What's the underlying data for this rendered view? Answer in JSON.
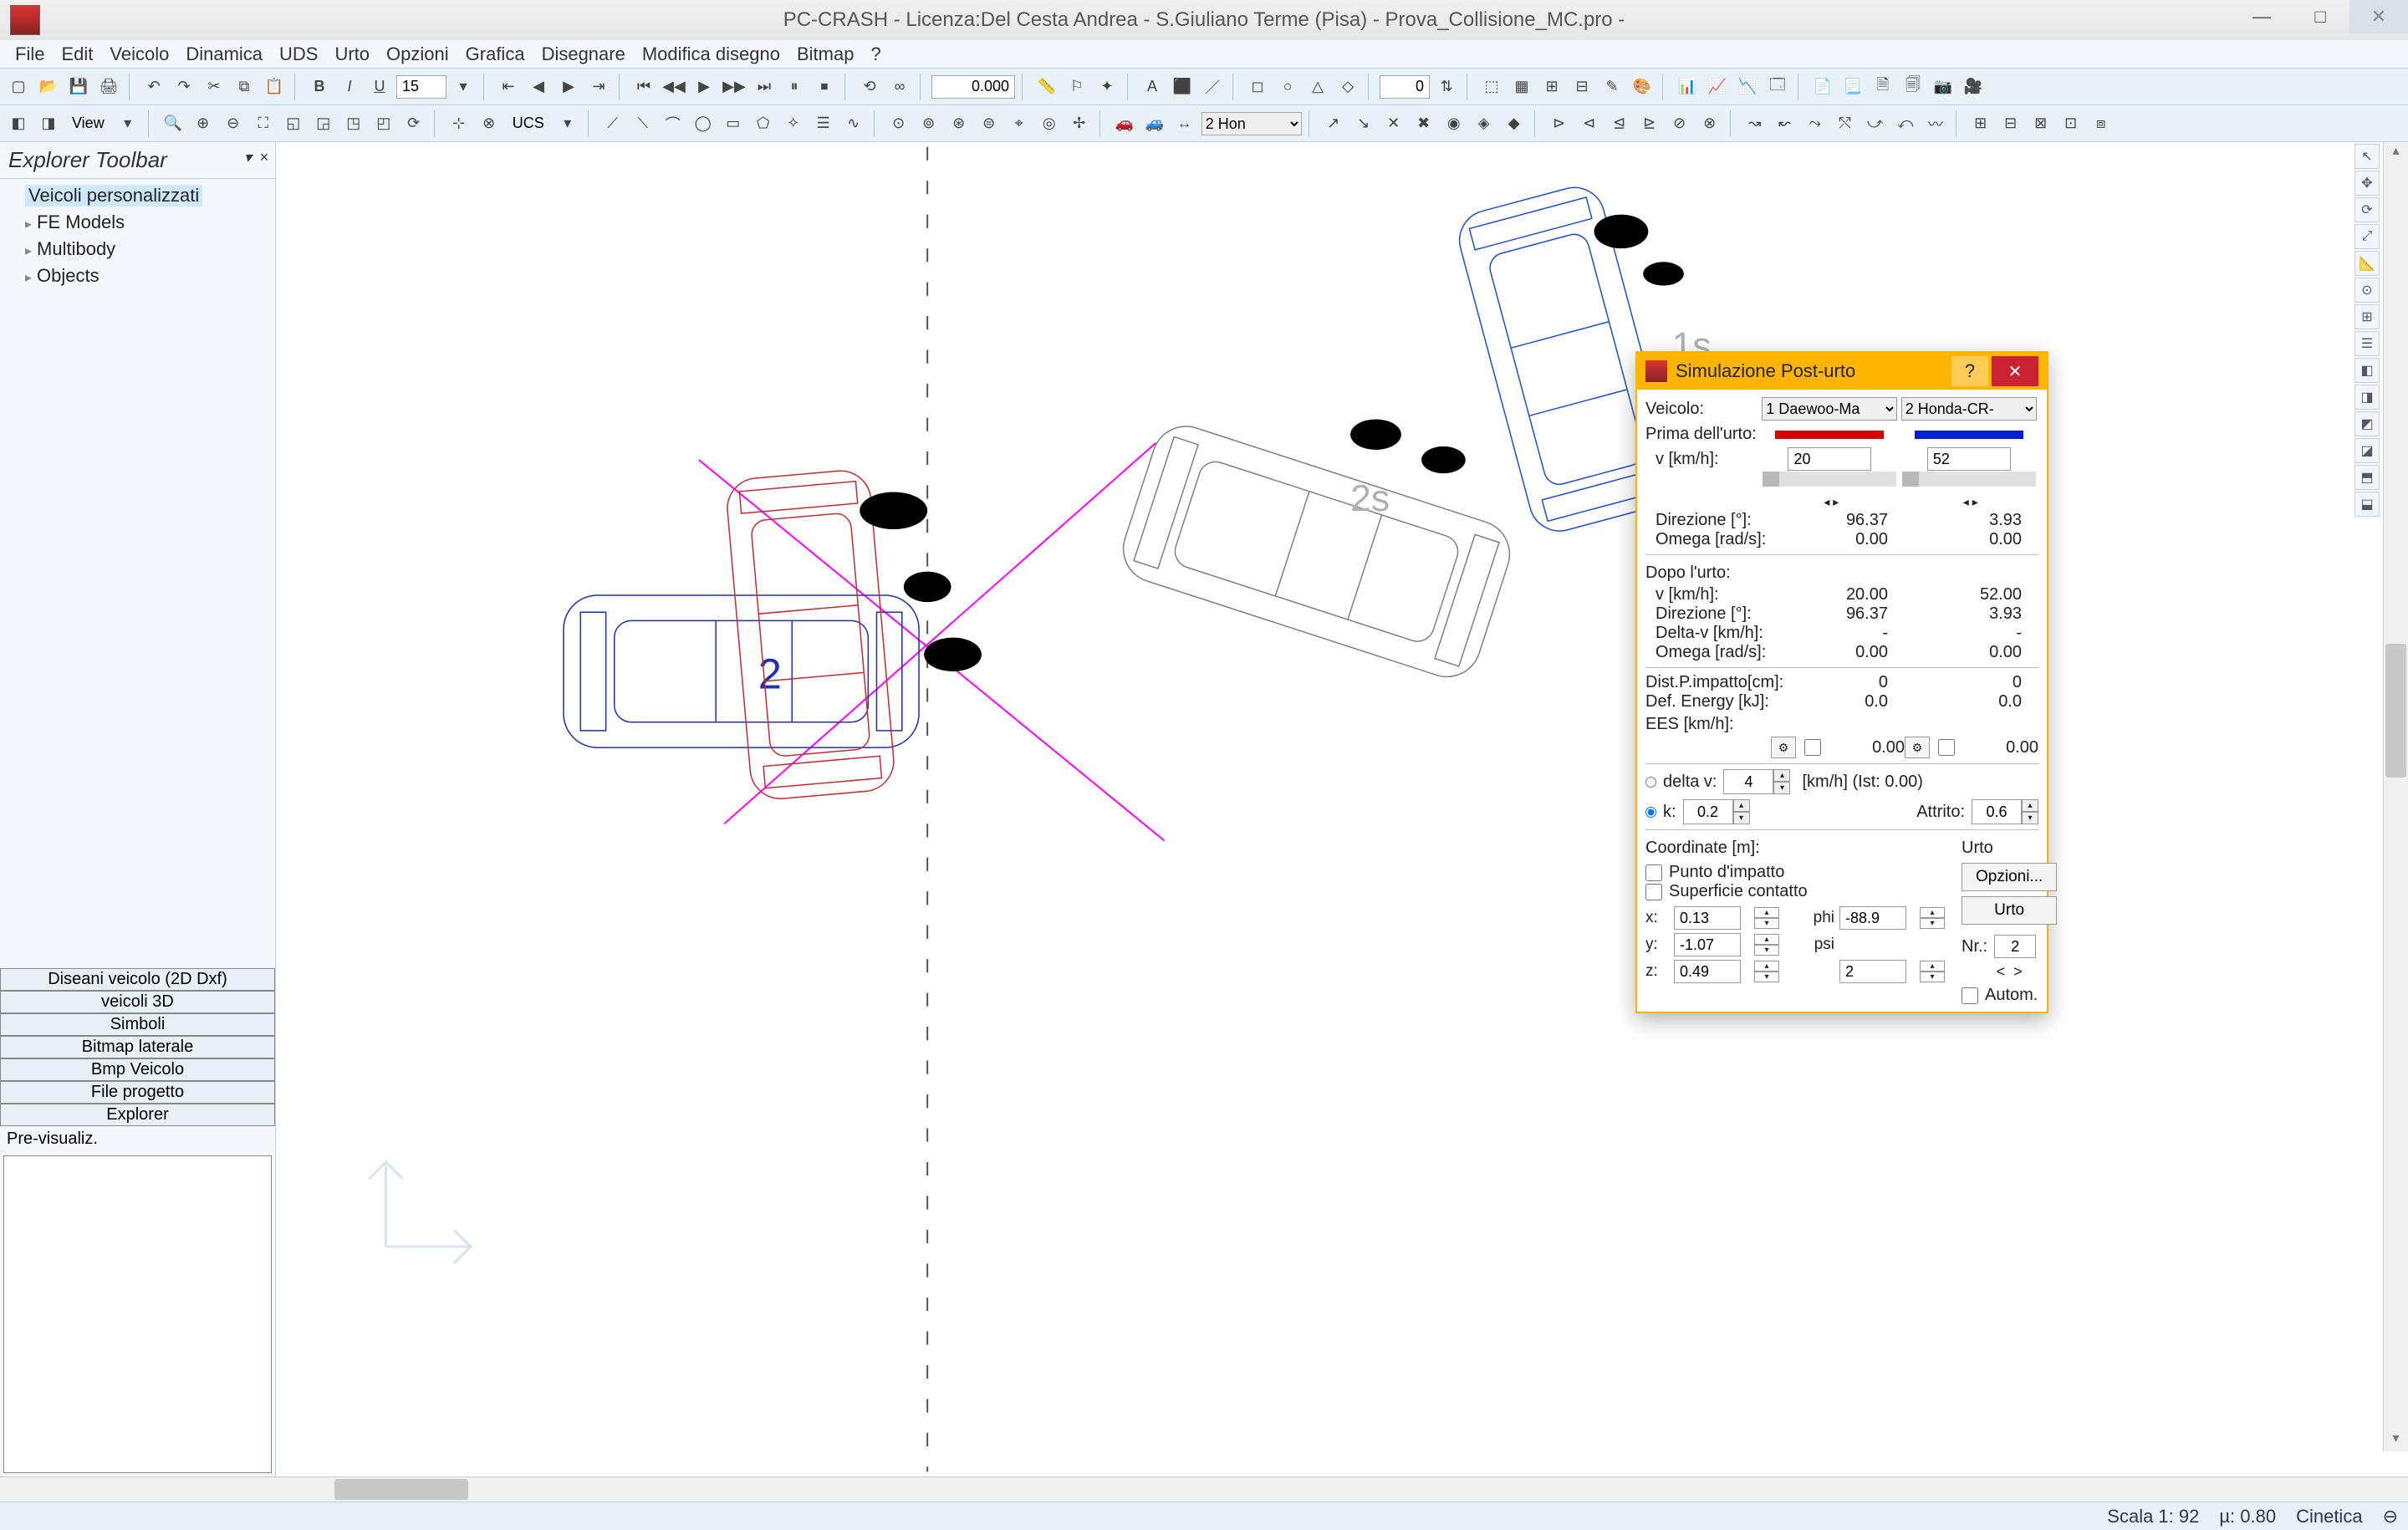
{
  "app": {
    "title": "PC-CRASH - Licenza:Del Cesta Andrea - S.Giuliano Terme (Pisa) - Prova_Collisione_MC.pro -"
  },
  "menu": [
    "File",
    "Edit",
    "Veicolo",
    "Dinamica",
    "UDS",
    "Urto",
    "Opzioni",
    "Grafica",
    "Disegnare",
    "Modifica disegno",
    "Bitmap",
    "?"
  ],
  "toolbar1": {
    "font_size": "15",
    "value1": "0.000",
    "value2": "0"
  },
  "toolbar2": {
    "view_label": "View",
    "ucs_label": "UCS",
    "vehicle_sel": "2  Hon"
  },
  "explorer": {
    "title": "Explorer Toolbar",
    "items": [
      "Veicoli personalizzati",
      "FE Models",
      "Multibody",
      "Objects"
    ],
    "selected_index": 0,
    "tabs": [
      "Diseani veicolo (2D Dxf)",
      "veicoli 3D",
      "Simboli",
      "Bitmap laterale",
      "Bmp Veicolo",
      "File progetto",
      "Explorer"
    ],
    "preview_label": "Pre-visualiz."
  },
  "canvas": {
    "labels": {
      "veh2": "2",
      "pos1s": "1s",
      "pos2s": "2s"
    }
  },
  "dialog": {
    "title": "Simulazione Post-urto",
    "labels": {
      "veicolo": "Veicolo:",
      "prima": "Prima dell'urto:",
      "v_kmh": "v [km/h]:",
      "direzione": "Direzione [°]:",
      "omega": "Omega [rad/s]:",
      "dopo": "Dopo l'urto:",
      "delta_v_kmh": "Delta-v [km/h]:",
      "dist": "Dist.P.impatto[cm]:",
      "def_energy": "Def. Energy [kJ]:",
      "ees": "EES [km/h]:",
      "delta_v": "delta v:",
      "k": "k:",
      "kmh_ist": "[km/h] (Ist: 0.00)",
      "attrito": "Attrito:",
      "coord": "Coordinate [m]:",
      "punto_imp": "Punto d'impatto",
      "superficie": "Superficie contatto",
      "x": "x:",
      "y": "y:",
      "z": "z:",
      "phi": "phi",
      "psi": "psi",
      "urto": "Urto",
      "opzioni": "Opzioni...",
      "urto_btn": "Urto",
      "nr": "Nr.:",
      "autom": "Autom."
    },
    "veh1": {
      "name": "1  Daewoo-Ma",
      "color": "#d40000"
    },
    "veh2": {
      "name": "2  Honda-CR-",
      "color": "#0020d4"
    },
    "prima": {
      "v": [
        "20",
        "52"
      ],
      "direzione": [
        "96.37",
        "3.93"
      ],
      "omega": [
        "0.00",
        "0.00"
      ]
    },
    "dopo": {
      "v": [
        "20.00",
        "52.00"
      ],
      "direzione": [
        "96.37",
        "3.93"
      ],
      "delta_v": [
        "-",
        "-"
      ],
      "omega": [
        "0.00",
        "0.00"
      ]
    },
    "impact": {
      "dist": [
        "0",
        "0"
      ],
      "def_energy": [
        "0.0",
        "0.0"
      ],
      "ees": [
        "0.00",
        "0.00"
      ]
    },
    "params": {
      "delta_v": "4",
      "k": "0.2",
      "attrito": "0.6"
    },
    "coords": {
      "x": "0.13",
      "y": "-1.07",
      "z": "0.49",
      "phi": "-88.9",
      "psi": "2"
    },
    "urto_nr": "2"
  },
  "status": {
    "scala": "Scala 1:  92",
    "mu": "µ: 0.80",
    "mode": "Cinetica"
  }
}
